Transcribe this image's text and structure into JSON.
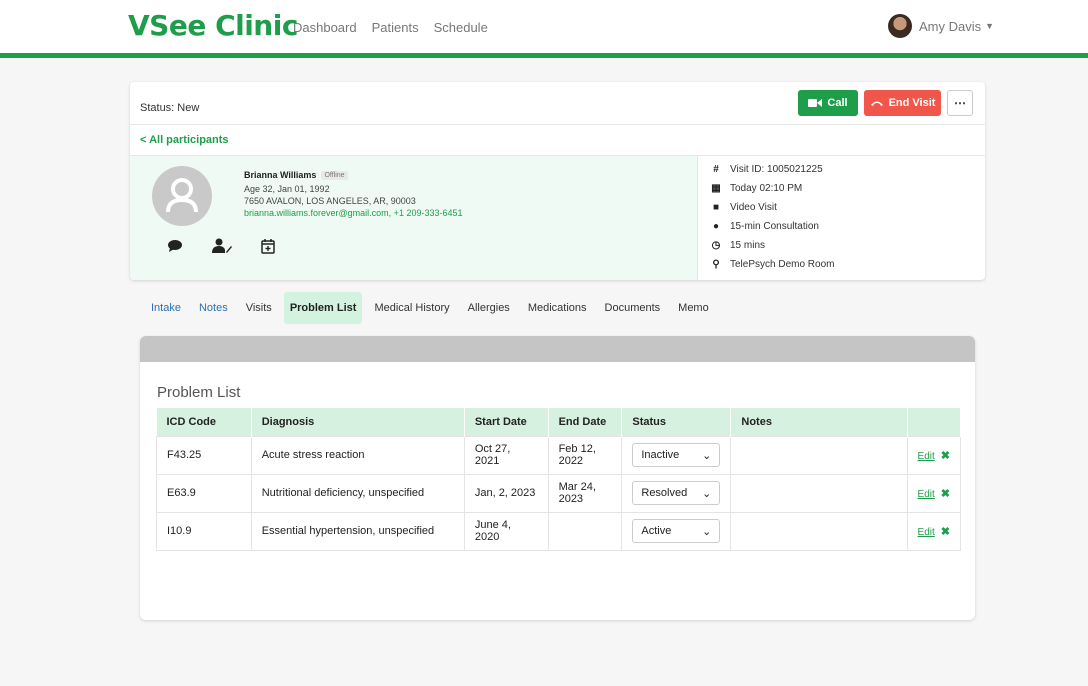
{
  "app": {
    "logo": "VSee Clinic",
    "nav": [
      "Dashboard",
      "Patients",
      "Schedule"
    ],
    "user_name": "Amy Davis"
  },
  "visit": {
    "status": "Status: New",
    "call_label": "Call",
    "end_label": "End Visit",
    "more_label": "⋯",
    "back_label": "< All participants"
  },
  "patient": {
    "name": "Brianna Williams",
    "presence": "Offline",
    "age_dob": "Age 32, Jan 01, 1992",
    "address": "7650 AVALON, LOS ANGELES, AR, 90003",
    "contact": "brianna.williams.forever@gmail.com, +1 209-333-6451"
  },
  "visit_info": {
    "id": "Visit ID: 1005021225",
    "time": "Today 02:10 PM",
    "type": "Video Visit",
    "reason": "15-min Consultation",
    "duration": "15 mins",
    "room": "TelePsych Demo Room"
  },
  "tabs": [
    "Intake",
    "Notes",
    "Visits",
    "Problem List",
    "Medical History",
    "Allergies",
    "Medications",
    "Documents",
    "Memo"
  ],
  "active_tab": "Problem List",
  "problem_list": {
    "title": "Problem List",
    "columns": [
      "ICD Code",
      "Diagnosis",
      "Start Date",
      "End Date",
      "Status",
      "Notes"
    ],
    "rows": [
      {
        "icd": "F43.25",
        "diagnosis": "Acute stress reaction",
        "start": "Oct 27, 2021",
        "end": "Feb 12, 2022",
        "status": "Inactive",
        "notes": ""
      },
      {
        "icd": "E63.9",
        "diagnosis": "Nutritional deficiency, unspecified",
        "start": "Jan, 2, 2023",
        "end": "Mar 24, 2023",
        "status": "Resolved",
        "notes": ""
      },
      {
        "icd": "I10.9",
        "diagnosis": "Essential hypertension, unspecified",
        "start": "June 4, 2020",
        "end": "",
        "status": "Active",
        "notes": ""
      }
    ],
    "edit_label": "Edit",
    "delete_label": "✖"
  },
  "colors": {
    "brand": "#1e9e4a",
    "danger": "#f0564a",
    "link": "#2f6fb3"
  }
}
